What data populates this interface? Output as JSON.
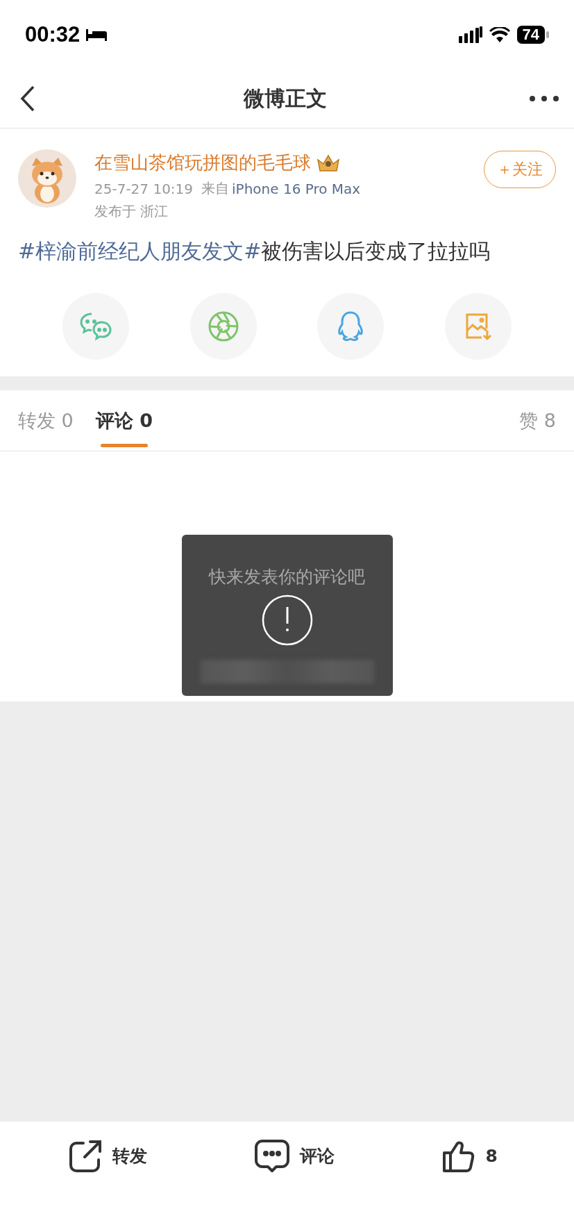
{
  "status_bar": {
    "time": "00:32",
    "battery": "74"
  },
  "nav": {
    "title": "微博正文"
  },
  "post": {
    "author": {
      "name": "在雪山茶馆玩拼图的毛毛球"
    },
    "follow_button": "＋关注",
    "timestamp": "25-7-27 10:19",
    "source_prefix": "来自",
    "source": "iPhone 16 Pro Max",
    "location": "发布于 浙江",
    "hashtag": "#梓渝前经纪人朋友发文#",
    "text": "被伤害以后变成了拉拉吗"
  },
  "share_buttons": [
    {
      "kind": "wechat"
    },
    {
      "kind": "moments"
    },
    {
      "kind": "qq"
    },
    {
      "kind": "save-image"
    }
  ],
  "tabs": [
    {
      "label": "转发 0",
      "selected": false
    },
    {
      "label": "评论 0",
      "selected": true
    }
  ],
  "likes_tab": "赞 8",
  "empty_state": "快来发表你的评论吧",
  "toast": {
    "kind": "alert"
  },
  "action_bar": [
    {
      "kind": "repost",
      "label": "转发"
    },
    {
      "kind": "comment",
      "label": "评论"
    },
    {
      "kind": "like",
      "label": "8"
    }
  ]
}
